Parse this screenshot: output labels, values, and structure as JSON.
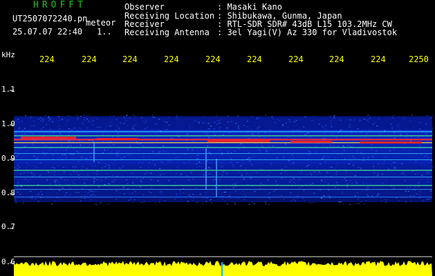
{
  "header": {
    "app_title": "HROFFT",
    "file_name": "UT2507072240.pn",
    "tag": "meteor",
    "datetime": "25.07.07 22:40",
    "counter": "1.."
  },
  "info": [
    {
      "label": "Observer",
      "value": ": Masaki Kano"
    },
    {
      "label": "Receiving Location",
      "value": ": Shibukawa, Gunma, Japan"
    },
    {
      "label": "Receiver",
      "value": ": RTL-SDR SDR# 43dB L15 103.2MHz CW"
    },
    {
      "label": "Receiving Antenna",
      "value": ": 3el Yagi(V) Az 330 for Vladivostok"
    }
  ],
  "axis": {
    "unit": "kHz",
    "time_ticks": [
      "224",
      "224",
      "224",
      "224",
      "224",
      "224",
      "224",
      "224",
      "224",
      "2250"
    ],
    "freq_labels": [
      "1.1",
      "1.0",
      "0.9",
      "0.8",
      "0.7",
      "0.6"
    ]
  },
  "colors": {
    "background": "#000000",
    "title": "#22c01e",
    "tick_text": "#ffff00",
    "signal_band": "#ff2020",
    "noise_blue": "#0a2ad0",
    "level_bar": "#ffff00",
    "grid_line": "#ffffff",
    "marker": "#00c0ff"
  }
}
